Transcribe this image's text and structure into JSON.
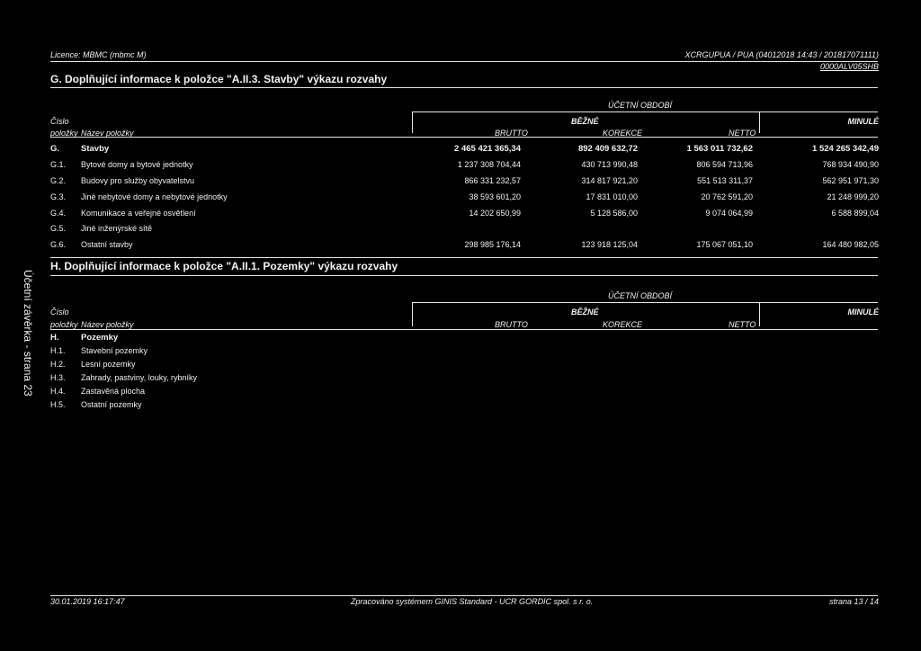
{
  "header": {
    "licence": "Licence: MBMC (mbmc M)",
    "code": "XCRGUPUA / PUA (04012018 14:43 / 201817071111)",
    "code2": "0000ALV05SHB"
  },
  "section_g": {
    "title": "G.   Doplňující informace k položce \"A.II.3. Stavby\" výkazu rozvahy",
    "col_cislo": "Číslo",
    "col_polozky": "položky",
    "col_nazev": "Název položky",
    "col_ucetni": "ÚČETNÍ OBDOBÍ",
    "col_bezne": "BĚŽNÉ",
    "col_minule": "MINULÉ",
    "col_brutto": "BRUTTO",
    "col_korekce": "KOREKCE",
    "col_netto": "NETTO",
    "rows": [
      {
        "code": "G.",
        "name": "Stavby",
        "brutto": "2 465 421 365,34",
        "korekce": "892 409 632,72",
        "netto": "1 563 011 732,62",
        "minule": "1 524 265 342,49"
      },
      {
        "code": "G.1.",
        "name": "Bytové domy a bytové jednotky",
        "brutto": "1 237 308 704,44",
        "korekce": "430 713 990,48",
        "netto": "806 594 713,96",
        "minule": "768 934 490,90"
      },
      {
        "code": "G.2.",
        "name": "Budovy pro služby obyvatelstvu",
        "brutto": "866 331 232,57",
        "korekce": "314 817 921,20",
        "netto": "551 513 311,37",
        "minule": "562 951 971,30"
      },
      {
        "code": "G.3.",
        "name": "Jiné nebytové domy a nebytové jednotky",
        "brutto": "38 593 601,20",
        "korekce": "17 831 010,00",
        "netto": "20 762 591,20",
        "minule": "21 248 999,20"
      },
      {
        "code": "G.4.",
        "name": "Komunikace a veřejné osvětlení",
        "brutto": "14 202 650,99",
        "korekce": "5 128 586,00",
        "netto": "9 074 064,99",
        "minule": "6 588 899,04"
      },
      {
        "code": "G.5.",
        "name": "Jiné inženýrské sítě",
        "brutto": "",
        "korekce": "",
        "netto": "",
        "minule": ""
      },
      {
        "code": "G.6.",
        "name": "Ostatní stavby",
        "brutto": "298 985 176,14",
        "korekce": "123 918 125,04",
        "netto": "175 067 051,10",
        "minule": "164 480 982,05"
      }
    ]
  },
  "section_h": {
    "title": "H.   Doplňující informace k položce \"A.II.1. Pozemky\" výkazu rozvahy",
    "col_cislo": "Číslo",
    "col_polozky": "položky",
    "col_nazev": "Název položky",
    "col_ucetni": "ÚČETNÍ OBDOBÍ",
    "col_bezne": "BĚŽNÉ",
    "col_minule": "MINULÉ",
    "col_brutto": "BRUTTO",
    "col_korekce": "KOREKCE",
    "col_netto": "NETTO",
    "rows": [
      {
        "code": "H.",
        "name": "Pozemky"
      },
      {
        "code": "H.1.",
        "name": "Stavební pozemky"
      },
      {
        "code": "H.2.",
        "name": "Lesní pozemky"
      },
      {
        "code": "H.3.",
        "name": "Zahrady, pastviny, louky, rybníky"
      },
      {
        "code": "H.4.",
        "name": "Zastavěná plocha"
      },
      {
        "code": "H.5.",
        "name": "Ostatní pozemky"
      }
    ]
  },
  "side_text": "Účetní závěrka - strana 23",
  "footer": {
    "date": "30.01.2019 16:17:47",
    "system": "Zpracováno systémem GINIS Standard - UCR GORDIC spol. s  r. o.",
    "page": "strana 13 / 14"
  }
}
